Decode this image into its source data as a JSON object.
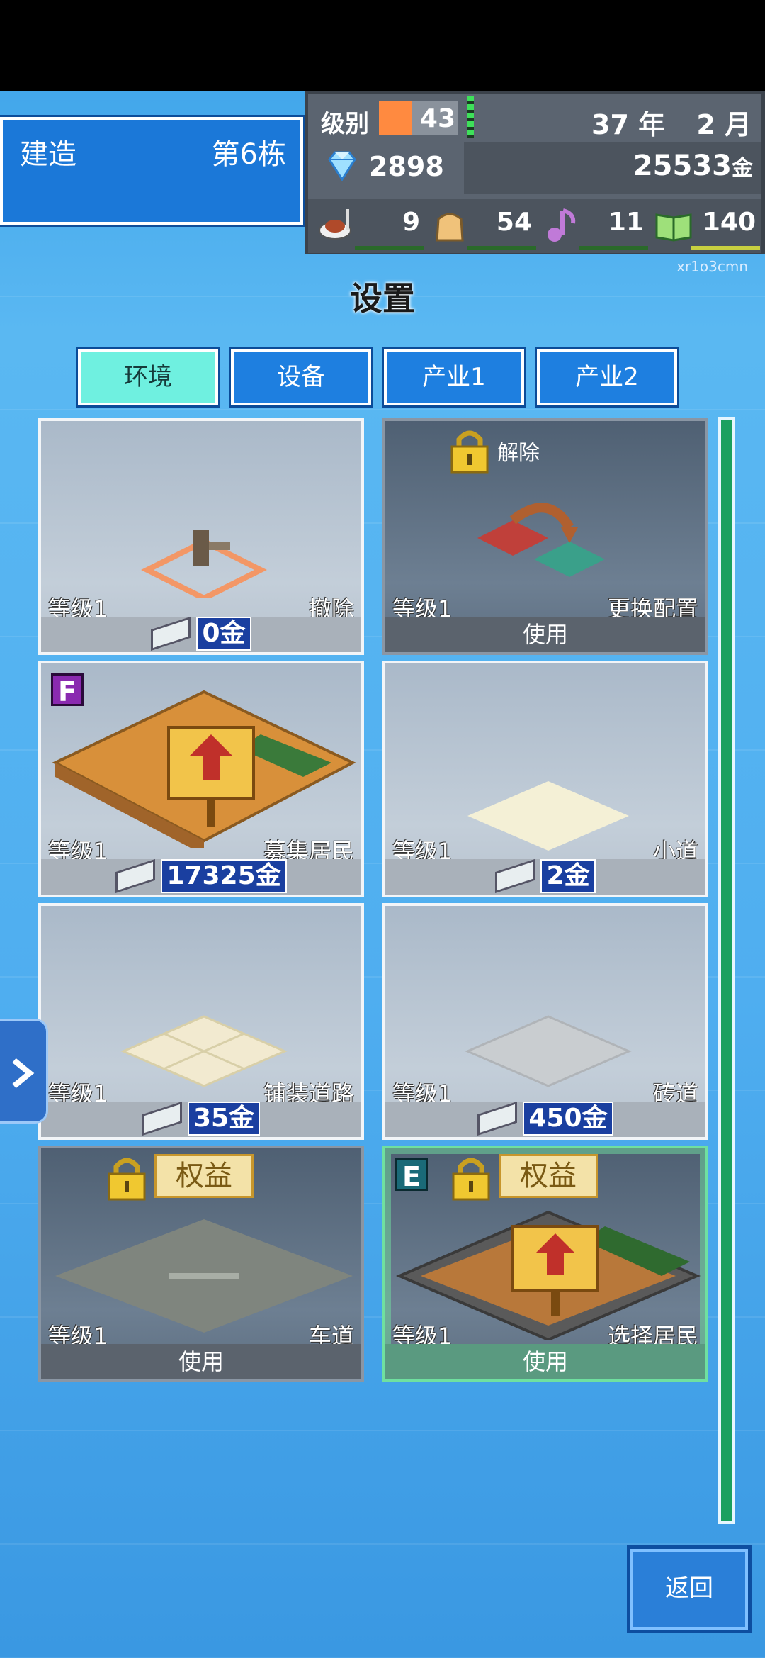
{
  "build": {
    "label": "建造",
    "floor": "第6栋"
  },
  "stats": {
    "level_label": "级别",
    "level": "43",
    "level_progress": 0.42,
    "year": "37 年",
    "month": "2 月",
    "gems": "2898",
    "gold": "25533",
    "gold_unit": "金",
    "resources": [
      {
        "icon": "food-icon",
        "value": "9"
      },
      {
        "icon": "bag-icon",
        "value": "54"
      },
      {
        "icon": "music-note-icon",
        "value": "11"
      },
      {
        "icon": "book-icon",
        "value": "140"
      }
    ]
  },
  "watermark": "xr1o3cmn",
  "title": "设置",
  "tabs": [
    {
      "label": "环境",
      "active": true
    },
    {
      "label": "设备",
      "active": false
    },
    {
      "label": "产业1",
      "active": false
    },
    {
      "label": "产业2",
      "active": false
    }
  ],
  "cards": [
    {
      "level": "等级1",
      "name": "撤除",
      "price": "0金"
    },
    {
      "level": "等级1",
      "name": "更换配置",
      "action": "使用",
      "lock_label": "解除"
    },
    {
      "level": "等级1",
      "name": "募集居民",
      "price": "17325金",
      "badge": "F"
    },
    {
      "level": "等级1",
      "name": "小道",
      "price": "2金"
    },
    {
      "level": "等级1",
      "name": "铺装道路",
      "price": "35金"
    },
    {
      "level": "等级1",
      "name": "砖道",
      "price": "450金"
    },
    {
      "level": "等级1",
      "name": "车道",
      "action": "使用",
      "rights": "权益"
    },
    {
      "level": "等级1",
      "name": "选择居民",
      "action": "使用",
      "rights": "权益",
      "badge": "E"
    }
  ],
  "back_label": "返回",
  "colors": {
    "accent": "#6ff0e0",
    "tab": "#1e7fe0",
    "price": "#1a3fa0",
    "scrollbar": "#1aa060"
  }
}
